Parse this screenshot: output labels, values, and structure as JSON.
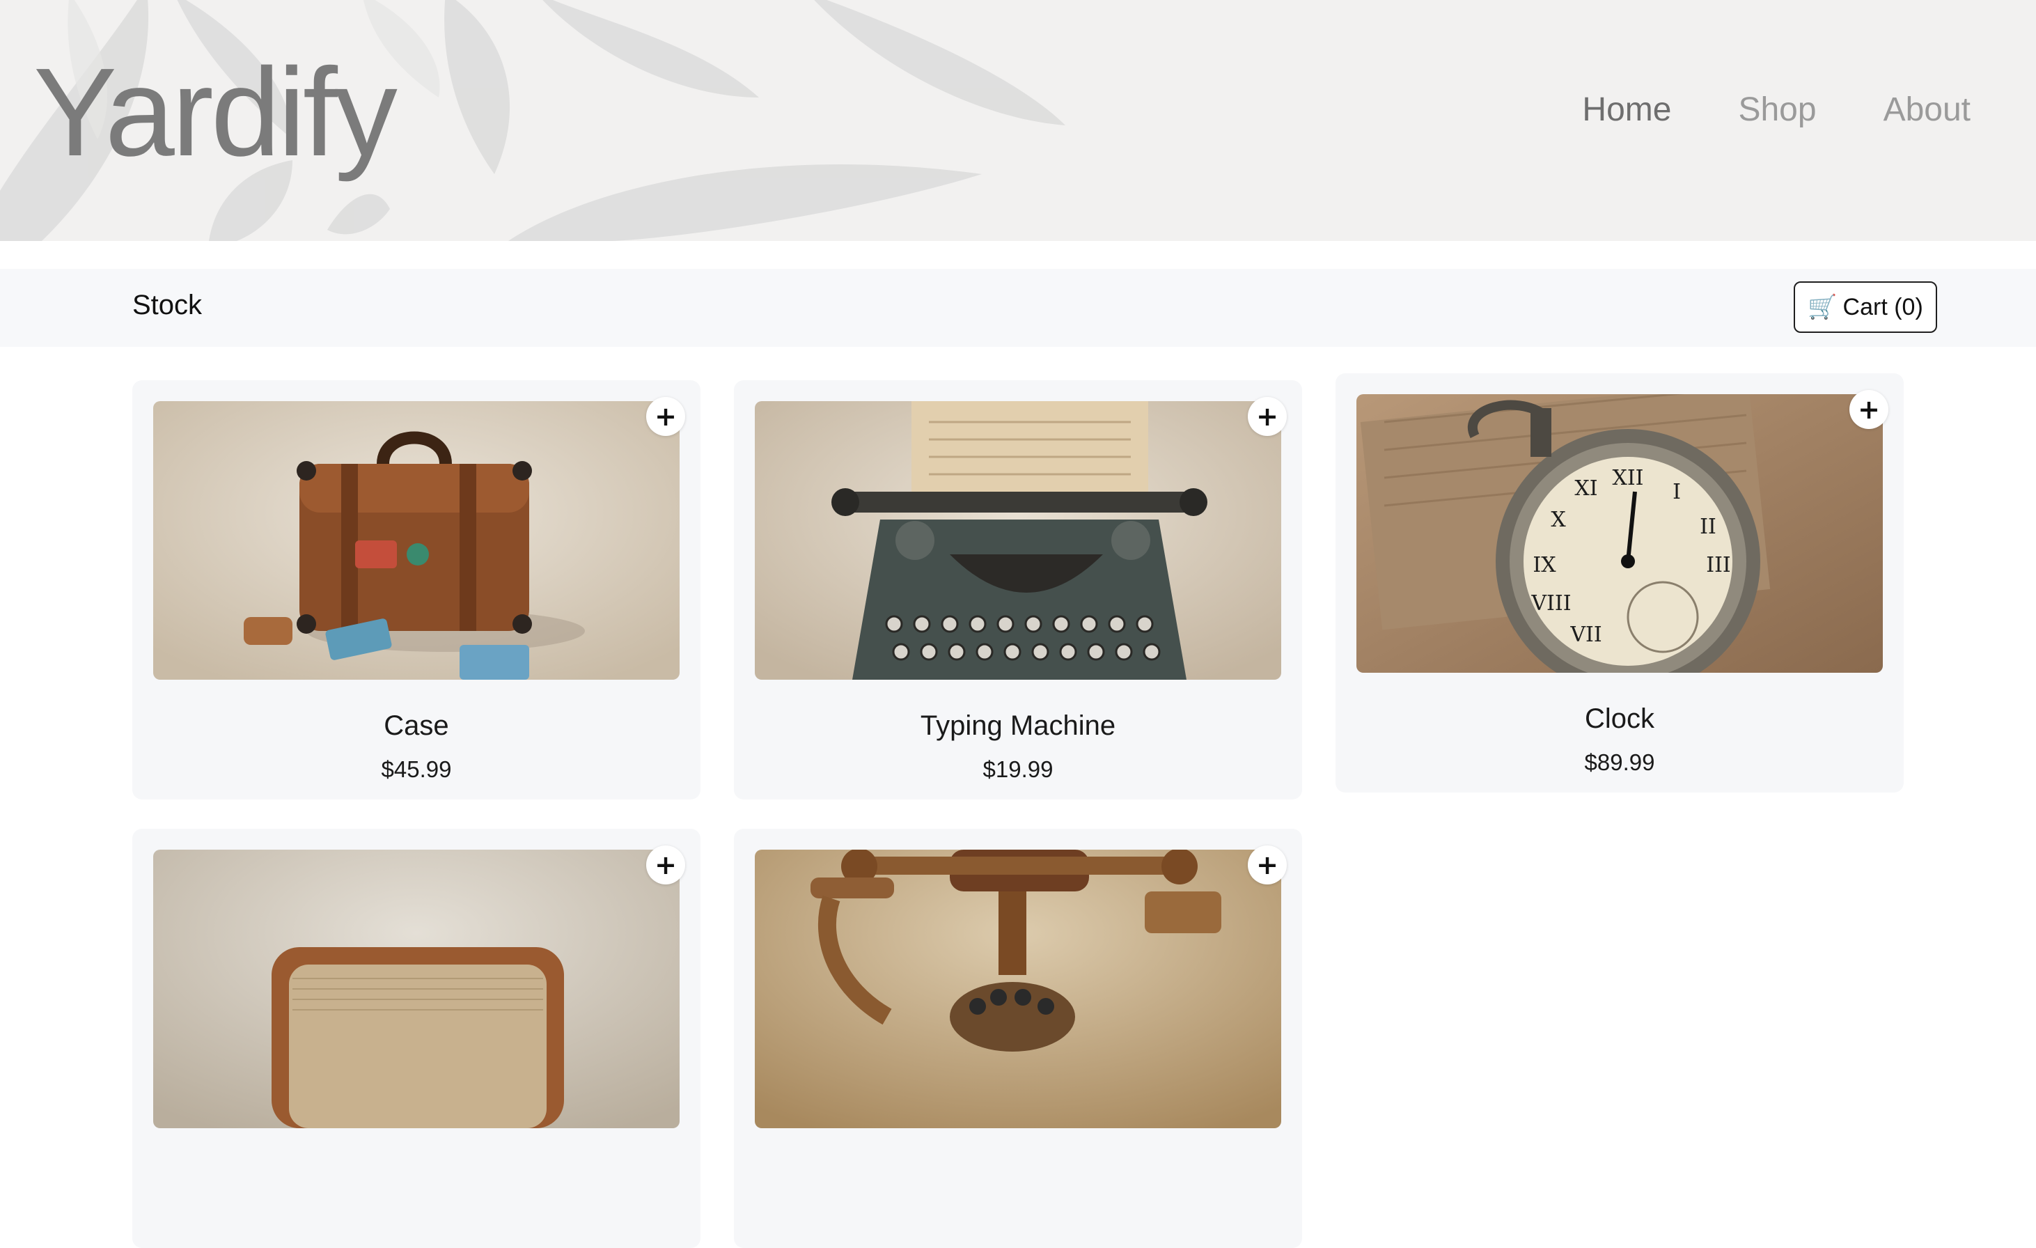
{
  "brand": {
    "name": "Yardify"
  },
  "nav": {
    "items": [
      {
        "label": "Home",
        "active": true
      },
      {
        "label": "Shop",
        "active": false
      },
      {
        "label": "About",
        "active": false
      }
    ]
  },
  "stock": {
    "title": "Stock",
    "cart_label": "Cart (0)",
    "cart_icon": "shopping-cart-icon"
  },
  "products": [
    {
      "name": "Case",
      "price": "$45.99",
      "add_icon": "+"
    },
    {
      "name": "Typing Machine",
      "price": "$19.99",
      "add_icon": "+"
    },
    {
      "name": "Clock",
      "price": "$89.99",
      "add_icon": "+"
    },
    {
      "name": "",
      "price": "",
      "add_icon": "+"
    },
    {
      "name": "",
      "price": "",
      "add_icon": "+"
    }
  ],
  "colors": {
    "brand_text": "#7b7b7b",
    "nav_active": "#6e6e6e",
    "nav_inactive": "#9a9a9a",
    "card_bg": "#f6f7f9",
    "stockbar_bg": "#f7f8fa"
  }
}
